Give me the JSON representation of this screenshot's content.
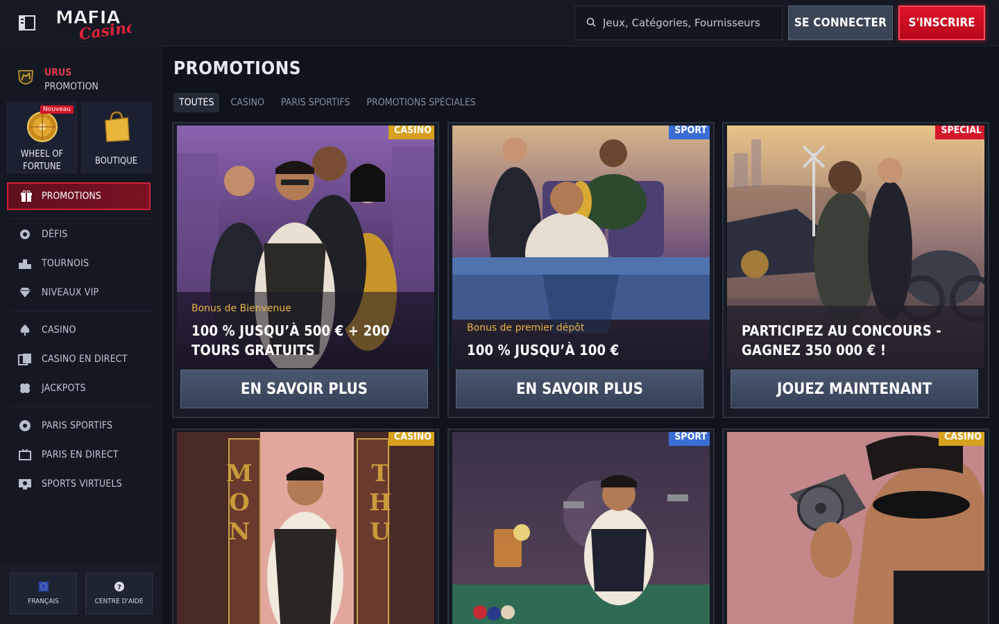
{
  "header": {
    "logo_text": "MAFIA Casino",
    "search_placeholder": "Jeux, Catégories, Fournisseurs",
    "login_label": "SE CONNECTER",
    "signup_label": "S'INSCRIRE"
  },
  "sidebar": {
    "promo_title": "URUS",
    "promo_sub": "PROMOTION",
    "tiles": [
      {
        "label_l1": "WHEEL OF",
        "label_l2": "FORTUNE",
        "badge": "Nouveau"
      },
      {
        "label": "BOUTIQUE"
      }
    ],
    "active": "PROMOTIONS",
    "items": [
      "DÉFIS",
      "TOURNOIS",
      "NIVEAUX VIP",
      "CASINO",
      "CASINO EN DIRECT",
      "JACKPOTS",
      "PARIS SPORTIFS",
      "PARIS EN DIRECT",
      "SPORTS VIRTUELS"
    ],
    "footer": {
      "language": "FRANÇAIS",
      "help": "CENTRE D'AIDE"
    }
  },
  "main": {
    "title": "PROMOTIONS",
    "tabs": [
      "TOUTES",
      "CASINO",
      "PARIS SPORTIFS",
      "PROMOTIONS SPÉCIALES"
    ],
    "cards": [
      {
        "tag": "CASINO",
        "subtitle": "Bonus de Bienvenue",
        "headline": "100 % JUSQU’À 500 € + 200 TOURS GRATUITS",
        "cta": "EN SAVOIR PLUS"
      },
      {
        "tag": "SPORT",
        "subtitle": "Bonus de premier dépôt",
        "headline": "100 % JUSQU’À 100 €",
        "cta": "EN SAVOIR PLUS"
      },
      {
        "tag": "SPÉCIAL",
        "subtitle": "",
        "headline": "PARTICIPEZ AU CONCOURS - GAGNEZ 350 000 €  !",
        "cta": "JOUEZ MAINTENANT"
      },
      {
        "tag": "CASINO",
        "door_left": "MON",
        "door_right": "THU"
      },
      {
        "tag": "SPORT"
      },
      {
        "tag": "CASINO"
      }
    ]
  },
  "colors": {
    "accent_red": "#d4172a",
    "casino_tag": "#d6a11f",
    "sport_tag": "#3a6ed4",
    "subtitle_gold": "#e8b543"
  }
}
